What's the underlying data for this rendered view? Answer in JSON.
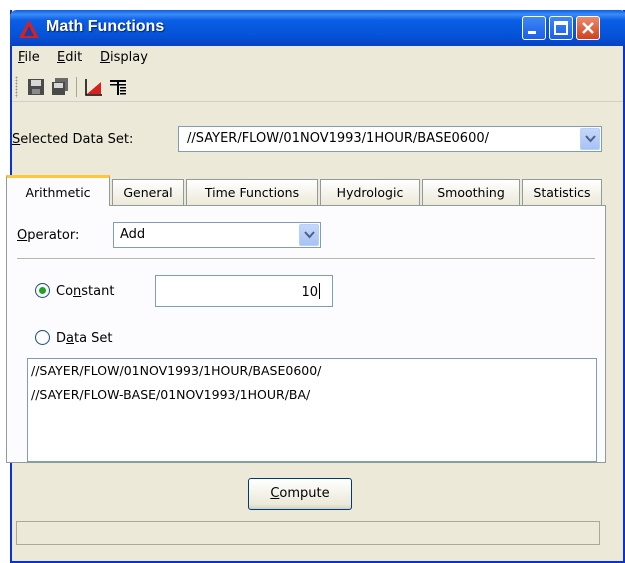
{
  "window": {
    "title": "Math Functions",
    "colors": {
      "titlebar": "#0a5fe6",
      "face": "#ece9d8",
      "active_tab_accent": "#ffc83c"
    }
  },
  "menu": {
    "items": [
      {
        "label": "File",
        "mnemonic": "F",
        "rest": "ile"
      },
      {
        "label": "Edit",
        "mnemonic": "E",
        "rest": "dit"
      },
      {
        "label": "Display",
        "mnemonic": "D",
        "rest": "isplay"
      }
    ]
  },
  "toolbar": {
    "icons": [
      "save-icon",
      "save-all-icon",
      "plot-icon",
      "table-icon"
    ]
  },
  "selected_data_set": {
    "label_mnemonic": "S",
    "label_rest": "elected Data Set:",
    "value": "//SAYER/FLOW/01NOV1993/1HOUR/BASE0600/"
  },
  "tabs": [
    {
      "label": "Arithmetic",
      "active": true
    },
    {
      "label": "General"
    },
    {
      "label": "Time Functions"
    },
    {
      "label": "Hydrologic"
    },
    {
      "label": "Smoothing"
    },
    {
      "label": "Statistics"
    }
  ],
  "arithmetic": {
    "operator_label_mnemonic": "O",
    "operator_label_rest": "perator:",
    "operator_value": "Add",
    "constant_label_pre": "Co",
    "constant_label_mnemonic": "n",
    "constant_label_post": "stant",
    "constant_checked": true,
    "constant_value": "10",
    "dataset_label_pre": "D",
    "dataset_label_mnemonic": "a",
    "dataset_label_post": "ta Set",
    "dataset_checked": false,
    "dataset_list": [
      "//SAYER/FLOW/01NOV1993/1HOUR/BASE0600/",
      "//SAYER/FLOW-BASE/01NOV1993/1HOUR/BA/"
    ]
  },
  "compute": {
    "mnemonic": "C",
    "rest": "ompute"
  },
  "status": {
    "text": ""
  }
}
